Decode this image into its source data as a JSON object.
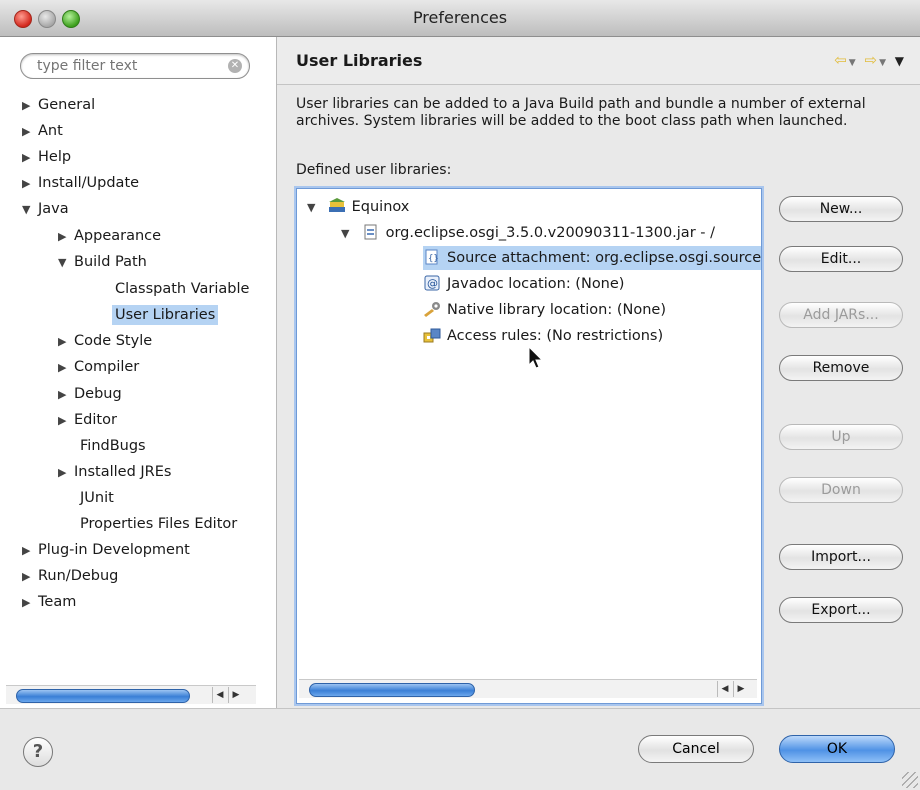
{
  "window": {
    "title": "Preferences"
  },
  "search": {
    "placeholder": "type filter text"
  },
  "tree": {
    "general": "General",
    "ant": "Ant",
    "help": "Help",
    "install_update": "Install/Update",
    "java": "Java",
    "appearance": "Appearance",
    "build_path": "Build Path",
    "classpath_variables": "Classpath Variable",
    "user_libraries": "User Libraries",
    "code_style": "Code Style",
    "compiler": "Compiler",
    "debug": "Debug",
    "editor": "Editor",
    "findbugs": "FindBugs",
    "installed_jres": "Installed JREs",
    "junit": "JUnit",
    "properties_files_editor": "Properties Files Editor",
    "plugin_development": "Plug-in Development",
    "run_debug": "Run/Debug",
    "team": "Team"
  },
  "page": {
    "title": "User Libraries",
    "description": "User libraries can be added to a Java Build path and bundle a number of external archives. System libraries will be added to the boot class path when launched.",
    "defined_label": "Defined user libraries:"
  },
  "libraries": {
    "equinox": "Equinox",
    "jar": "org.eclipse.osgi_3.5.0.v20090311-1300.jar - /",
    "source": "Source attachment: org.eclipse.osgi.source",
    "javadoc": "Javadoc location: (None)",
    "native": "Native library location: (None)",
    "access": "Access rules: (No restrictions)"
  },
  "buttons": {
    "new": "New...",
    "edit": "Edit...",
    "add_jars": "Add JARs...",
    "remove": "Remove",
    "up": "Up",
    "down": "Down",
    "import": "Import...",
    "export": "Export...",
    "cancel": "Cancel",
    "ok": "OK"
  },
  "colors": {
    "selection": "#b5d3f3",
    "default_button": "#4f92e5",
    "nav_arrow": "#e2bc3a"
  }
}
